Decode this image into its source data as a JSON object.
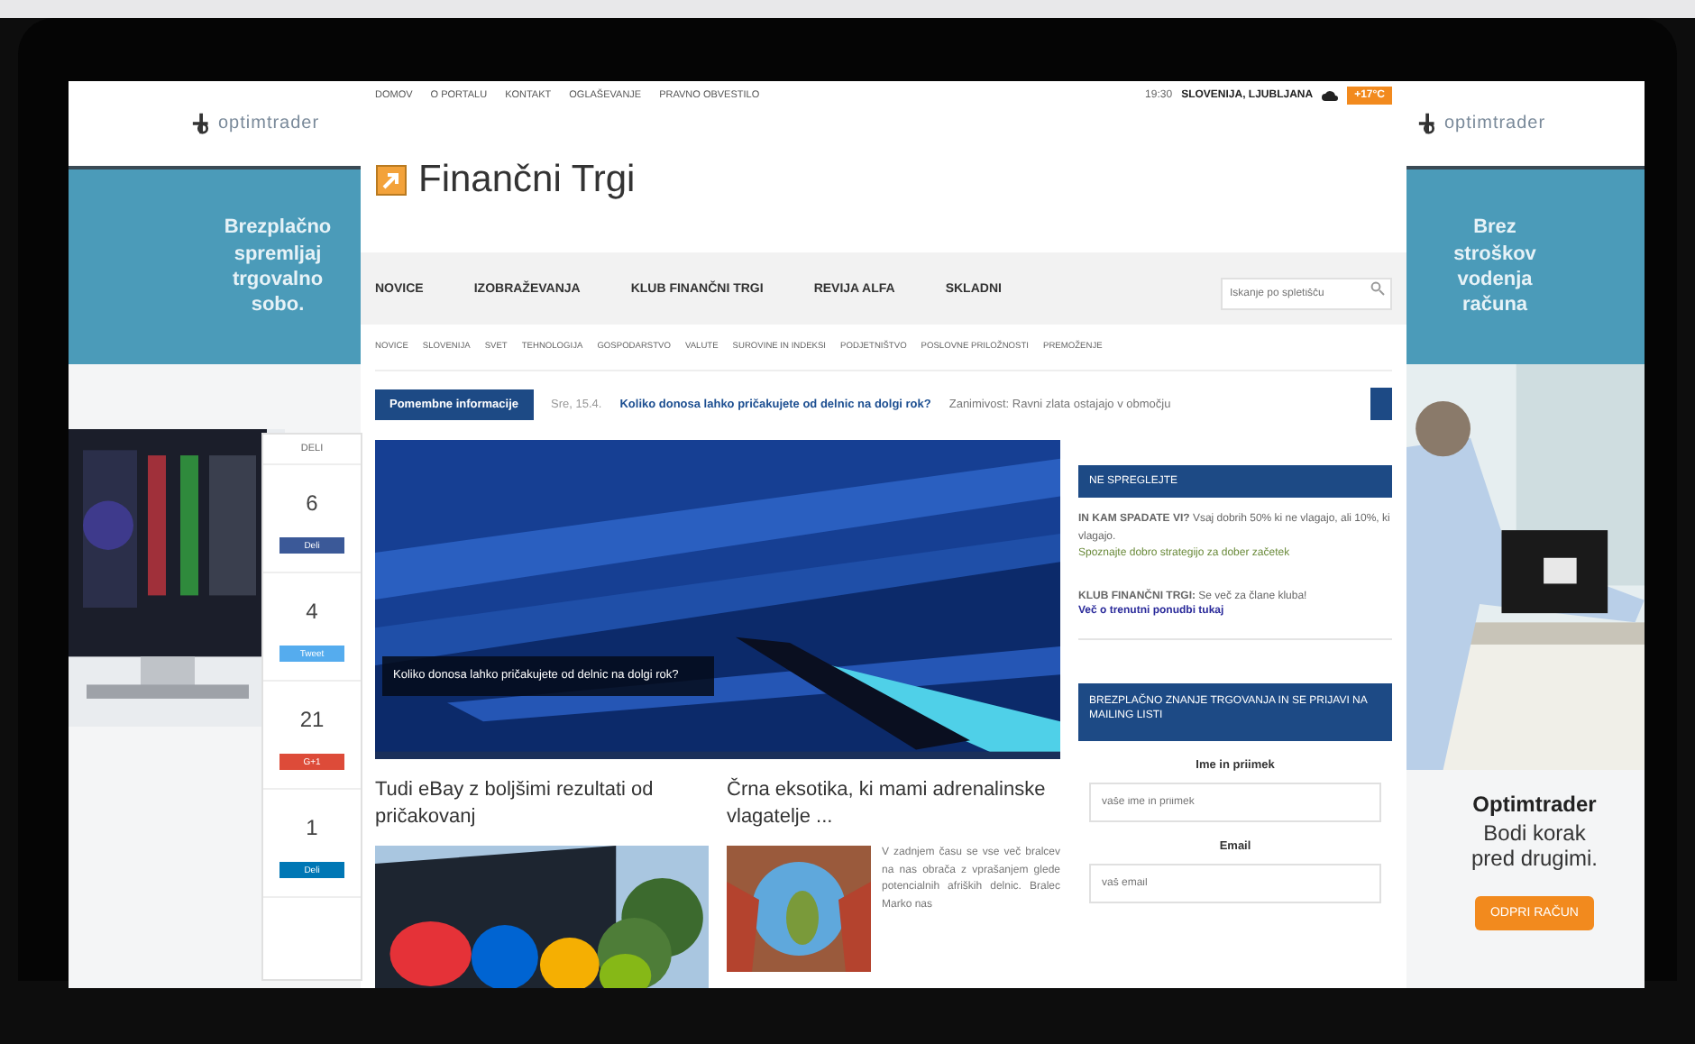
{
  "left_ad": {
    "logo": "optimtrader",
    "headline": "Brezplačno spremljaj trgovalno sobo."
  },
  "top_bar": {
    "links": [
      "DOMOV",
      "O PORTALU",
      "KONTAKT",
      "OGLAŠEVANJE",
      "PRAVNO OBVESTILO"
    ],
    "time": "19:30",
    "location": "SLOVENIJA, LJUBLJANA",
    "temperature": "+17°C"
  },
  "site": {
    "title": "Finančni Trgi"
  },
  "nav": {
    "items": [
      {
        "label": "NOVICE",
        "selected": false
      },
      {
        "label": "IZOBRAŽEVANJA",
        "selected": false
      },
      {
        "label": "KLUB FINANČNI TRGI",
        "selected": false
      },
      {
        "label": "REVIJA ALFA",
        "selected": false
      },
      {
        "label": "SKLADNI",
        "selected": false
      }
    ],
    "search": {
      "placeholder": "Iskanje po spletišču"
    }
  },
  "subnav": [
    "NOVICE",
    "SLOVENIJA",
    "SVET",
    "TEHNOLOGIJA",
    "GOSPODARSTVO",
    "VALUTE",
    "SUROVINE IN INDEKSI",
    "PODJETNIŠTVO",
    "POSLOVNE PRILOŽNOSTI",
    "PREMOŽENJE"
  ],
  "ticker": {
    "label": "Pomembne informacije",
    "date": "Sre, 15.4.",
    "headline": "Koliko donosa lahko pričakujete od delnic na dolgi rok?",
    "next": "Zanimivost: Ravni zlata ostajajo v območju"
  },
  "hero": {
    "caption": "Koliko donosa lahko pričakujete od delnic na dolgi rok?"
  },
  "articles": [
    {
      "title": "Tudi eBay z boljšimi rezultati od pričakovanj"
    },
    {
      "title": "Črna eksotika, ki mami adrenalinske vlagatelje ...",
      "excerpt": "V zadnjem času se vse več bralcev na nas obrača z vprašanjem glede potencialnih afriških delnic. Bralec Marko nas"
    }
  ],
  "sidebar": {
    "header": "NE SPREGLEJTE",
    "promo": "**IN KAM SPADATE VI?** Vsaj dobrih 50% ki ne vlagajo, ali 10%, ki vlagajo.",
    "promo_note": "Spoznajte dobro strategijo za dober začetek",
    "club": "**KLUB FINANČNI TRGI:** Se več za člane kluba!",
    "club_link": "Več o trenutni ponudbi tukaj",
    "signup_header": "BREZPLAČNO ZNANJE TRGOVANJA IN SE PRIJAVI NA MAILING LISTI",
    "fields": [
      {
        "label": "Ime in priimek",
        "placeholder": "vaše ime in priimek"
      },
      {
        "label": "Email",
        "placeholder": "vaš email"
      }
    ]
  },
  "share_bar": {
    "label": "DELI",
    "items": [
      {
        "kind": "facebook",
        "count": "6",
        "label": "Deli"
      },
      {
        "kind": "twitter",
        "count": "4",
        "label": "Tweet"
      },
      {
        "kind": "google",
        "count": "21",
        "label": "G+1"
      },
      {
        "kind": "linkedin",
        "count": "1",
        "label": "Deli"
      }
    ]
  },
  "right_ad": {
    "logo": "optimtrader",
    "headline": "Brez stroškov vodenja računa",
    "brand": "Optimtrader",
    "slogan": "Bodi korak pred drugimi.",
    "button": "ODPRI RAČUN"
  }
}
